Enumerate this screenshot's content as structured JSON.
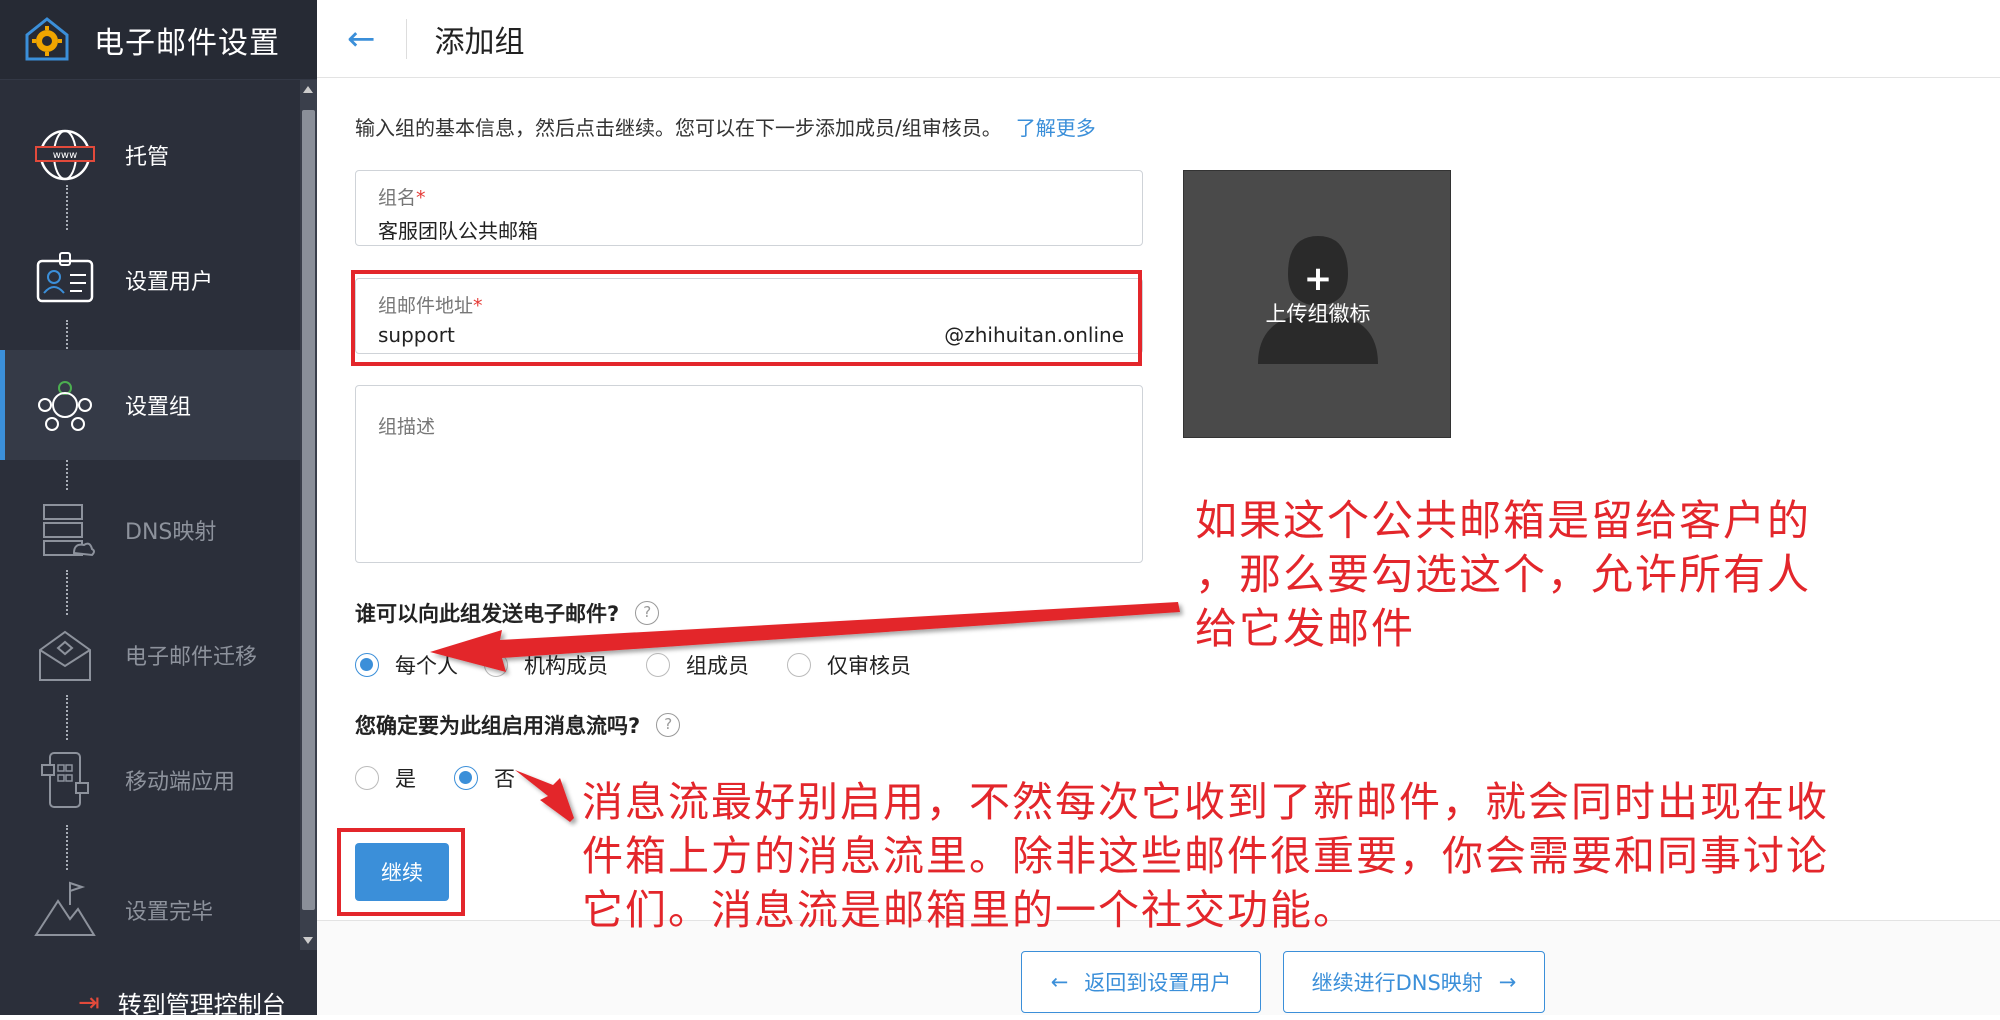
{
  "app": {
    "title": "电子邮件设置"
  },
  "sidebar": {
    "steps": [
      {
        "label": "托管",
        "icon": "globe-www-icon",
        "state": "done"
      },
      {
        "label": "设置用户",
        "icon": "user-card-icon",
        "state": "done"
      },
      {
        "label": "设置组",
        "icon": "group-icon",
        "state": "active"
      },
      {
        "label": "DNS映射",
        "icon": "dns-server-icon",
        "state": "disabled"
      },
      {
        "label": "电子邮件迁移",
        "icon": "mail-migration-icon",
        "state": "disabled"
      },
      {
        "label": "移动端应用",
        "icon": "mobile-app-icon",
        "state": "disabled"
      },
      {
        "label": "设置完毕",
        "icon": "mountain-flag-icon",
        "state": "disabled"
      }
    ],
    "console_link": "转到管理控制台"
  },
  "header": {
    "back_icon": "back-arrow-icon",
    "title": "添加组"
  },
  "intro": {
    "text": "输入组的基本信息，然后点击继续。您可以在下一步添加成员/组审核员。",
    "link": "了解更多"
  },
  "form": {
    "group_name": {
      "label": "组名",
      "required_mark": "*",
      "value": "客服团队公共邮箱"
    },
    "group_email": {
      "label": "组邮件地址",
      "required_mark": "*",
      "value": "support",
      "domain": "@zhihuitan.online"
    },
    "group_description": {
      "placeholder": "组描述"
    },
    "logo_upload": {
      "plus": "+",
      "label": "上传组徽标"
    },
    "who_can_send": {
      "question": "谁可以向此组发送电子邮件?",
      "help": "?",
      "options": [
        "每个人",
        "机构成员",
        "组成员",
        "仅审核员"
      ],
      "selected": "每个人"
    },
    "stream": {
      "question": "您确定要为此组启用消息流吗?",
      "help": "?",
      "options": [
        "是",
        "否"
      ],
      "selected": "否"
    },
    "continue_label": "继续"
  },
  "footer": {
    "back_label": "返回到设置用户",
    "next_label": "继续进行DNS映射",
    "back_arrow": "←",
    "next_arrow": "→"
  },
  "annotations": {
    "note1": [
      "如果这个公共邮箱是留给客户的",
      "，那么要勾选这个，允许所有人",
      "给它发邮件"
    ],
    "note2": [
      "消息流最好别启用，不然每次它收到了新邮件，就会同时出现在收",
      "件箱上方的消息流里。除非这些邮件很重要，你会需要和同事讨论",
      "它们。消息流是邮箱里的一个社交功能。"
    ]
  },
  "colors": {
    "accent": "#3b8fd9",
    "sidebar": "#2b2f3a",
    "annotation": "#e3262b"
  }
}
